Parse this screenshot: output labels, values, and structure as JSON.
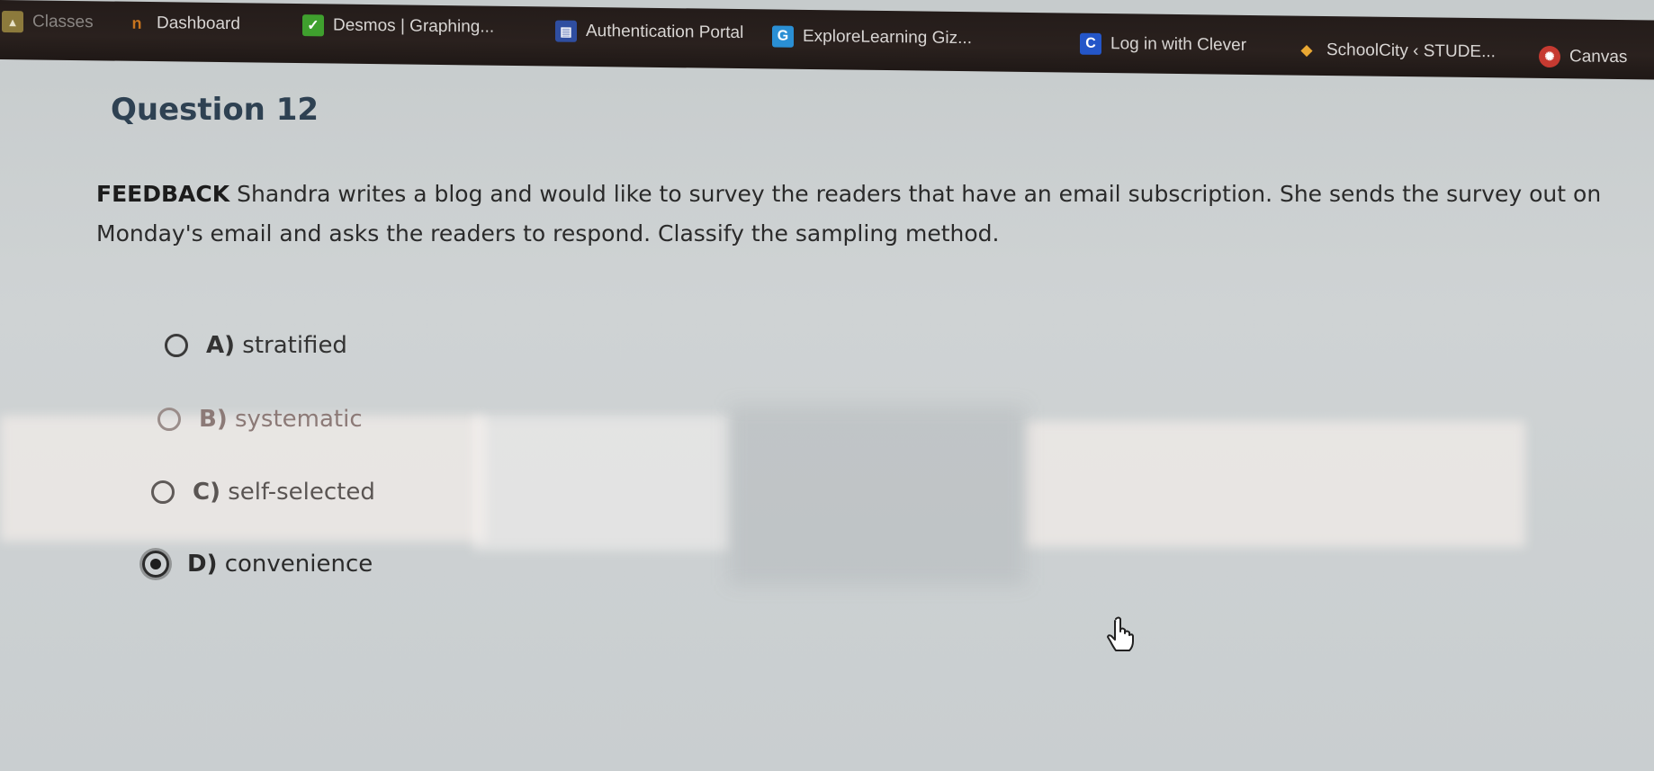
{
  "bookmarks": [
    {
      "label": "Classes",
      "icon": "classroom-icon",
      "glyph": "▲"
    },
    {
      "label": "Dashboard",
      "icon": "dashboard-icon",
      "glyph": "n"
    },
    {
      "label": "Desmos | Graphing...",
      "icon": "desmos-icon",
      "glyph": "✓"
    },
    {
      "label": "Authentication Portal",
      "icon": "auth-portal-icon",
      "glyph": "▤"
    },
    {
      "label": "ExploreLearning Giz...",
      "icon": "explorelearning-icon",
      "glyph": "G"
    },
    {
      "label": "Log in with Clever",
      "icon": "clever-icon",
      "glyph": "C"
    },
    {
      "label": "SchoolCity ‹ STUDE...",
      "icon": "schoolcity-icon",
      "glyph": "◆"
    },
    {
      "label": "Canvas",
      "icon": "canvas-icon",
      "glyph": "✺"
    }
  ],
  "question": {
    "title": "Question 12",
    "tag": "FEEDBACK",
    "text": "Shandra writes a blog and would like to survey the readers that have an email subscription. She sends the survey out on Monday's email and asks the readers to respond. Classify the sampling method."
  },
  "options": [
    {
      "letter": "A)",
      "text": "stratified",
      "selected": false
    },
    {
      "letter": "B)",
      "text": "systematic",
      "selected": false
    },
    {
      "letter": "C)",
      "text": "self-selected",
      "selected": false
    },
    {
      "letter": "D)",
      "text": "convenience",
      "selected": true
    }
  ],
  "cursor": {
    "type": "hand-pointer-icon"
  }
}
